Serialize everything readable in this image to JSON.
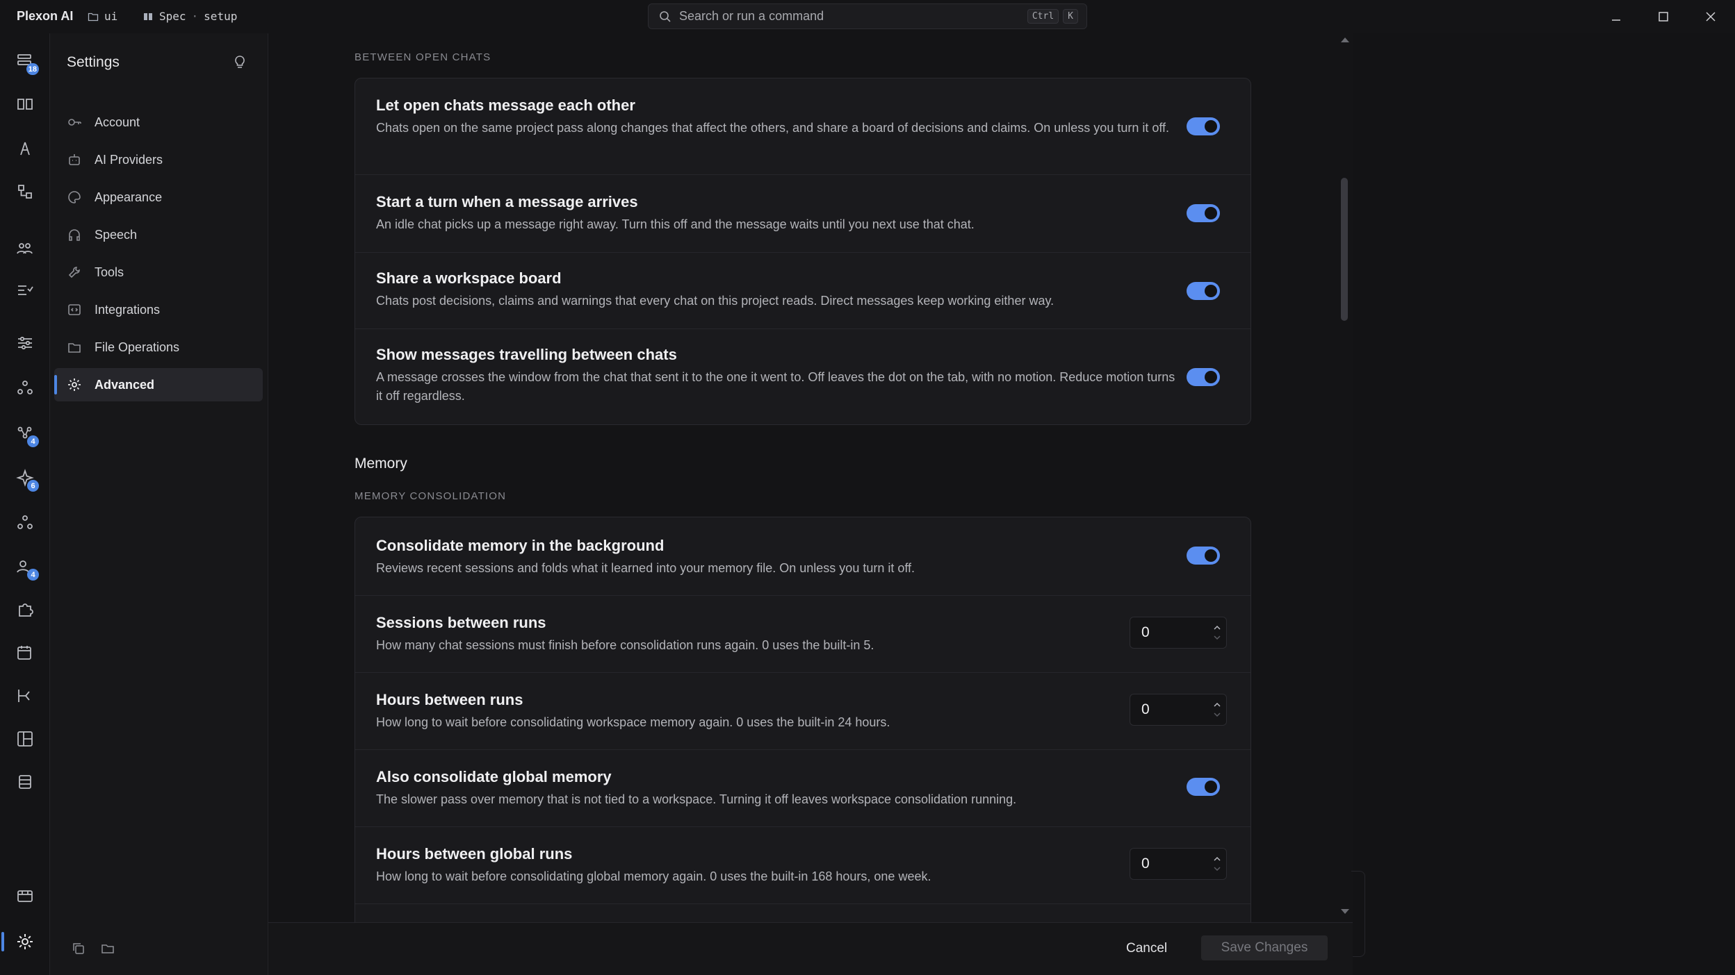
{
  "titlebar": {
    "app_name": "Plexon AI",
    "folder": "ui",
    "spec_label": "Spec",
    "spec_separator": "·",
    "spec_name": "setup",
    "search_placeholder": "Search or run a command",
    "shortcut_ctrl": "Ctrl",
    "shortcut_key": "K"
  },
  "rail": {
    "badges": {
      "chats": "18",
      "agents": "4",
      "skills": "6",
      "people": "4"
    }
  },
  "sidebar": {
    "title": "Settings",
    "items": [
      {
        "label": "Account",
        "icon": "key-icon"
      },
      {
        "label": "AI Providers",
        "icon": "robot-icon"
      },
      {
        "label": "Appearance",
        "icon": "palette-icon"
      },
      {
        "label": "Speech",
        "icon": "headphones-icon"
      },
      {
        "label": "Tools",
        "icon": "wrench-icon"
      },
      {
        "label": "Integrations",
        "icon": "plug-icon"
      },
      {
        "label": "File Operations",
        "icon": "folder-icon"
      },
      {
        "label": "Advanced",
        "icon": "gear-icon",
        "active": true
      }
    ]
  },
  "main": {
    "section1_label": "BETWEEN OPEN CHATS",
    "chats_rows": [
      {
        "title": "Let open chats message each other",
        "desc": "Chats open on the same project pass along changes that affect the others, and share a board of decisions and claims. On unless you turn it off.",
        "enabled": true
      },
      {
        "title": "Start a turn when a message arrives",
        "desc": "An idle chat picks up a message right away. Turn this off and the message waits until you next use that chat.",
        "enabled": true
      },
      {
        "title": "Share a workspace board",
        "desc": "Chats post decisions, claims and warnings that every chat on this project reads. Direct messages keep working either way.",
        "enabled": true
      },
      {
        "title": "Show messages travelling between chats",
        "desc": "A message crosses the window from the chat that sent it to the one it went to. Off leaves the dot on the tab, with no motion. Reduce motion turns it off regardless.",
        "enabled": true
      }
    ],
    "memory_heading": "Memory",
    "section2_label": "MEMORY CONSOLIDATION",
    "memory_rows": [
      {
        "title": "Consolidate memory in the background",
        "desc": "Reviews recent sessions and folds what it learned into your memory file. On unless you turn it off.",
        "type": "toggle",
        "enabled": true
      },
      {
        "title": "Sessions between runs",
        "desc": "How many chat sessions must finish before consolidation runs again. 0 uses the built-in 5.",
        "type": "number",
        "value": "0"
      },
      {
        "title": "Hours between runs",
        "desc": "How long to wait before consolidating workspace memory again. 0 uses the built-in 24 hours.",
        "type": "number",
        "value": "0"
      },
      {
        "title": "Also consolidate global memory",
        "desc": "The slower pass over memory that is not tied to a workspace. Turning it off leaves workspace consolidation running.",
        "type": "toggle",
        "enabled": true
      },
      {
        "title": "Hours between global runs",
        "desc": "How long to wait before consolidating global memory again. 0 uses the built-in 168 hours, one week.",
        "type": "number",
        "value": "0"
      }
    ]
  },
  "footer": {
    "cancel_label": "Cancel",
    "save_label": "Save Changes"
  },
  "colors": {
    "accent": "#4d86e3",
    "toggle_on": "#5b8ef0",
    "background": "#141416",
    "card": "#1a1a1d"
  }
}
